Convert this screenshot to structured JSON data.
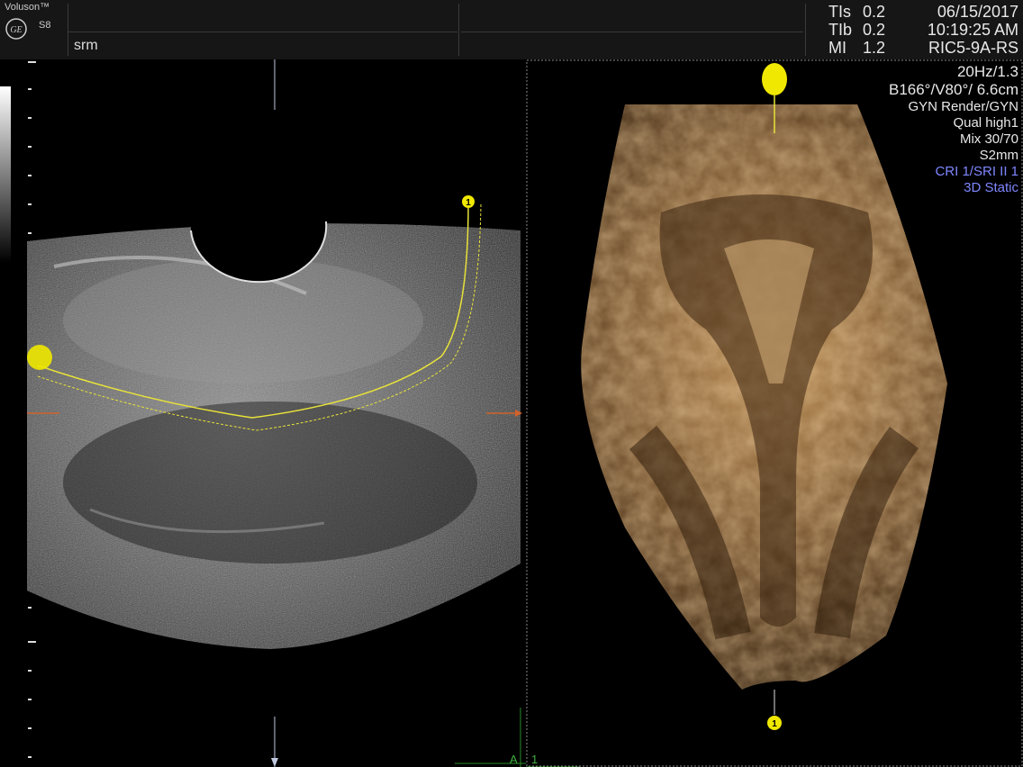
{
  "header": {
    "brand": "Voluson™",
    "logo_text": "GE",
    "model": "S8",
    "patient_id": "srm",
    "params": [
      {
        "label": "TIs",
        "value": "0.2"
      },
      {
        "label": "TIb",
        "value": "0.2"
      },
      {
        "label": "MI",
        "value": "1.2"
      }
    ],
    "date": "06/15/2017",
    "time": "10:19:25 AM",
    "probe": "RIC5-9A-RS"
  },
  "acquisition": {
    "frame_rate": "20Hz/1.3",
    "angles_depth": "B166°/V80°/ 6.6cm",
    "preset": "GYN Render/GYN",
    "quality": "Qual high1",
    "mix": "Mix 30/70",
    "slice": "S2mm",
    "cri_sri": "CRI 1/SRI II 1",
    "mode": "3D Static"
  },
  "markers": {
    "curve_marker": "1",
    "render_marker": "1",
    "plane_label": "A",
    "plane_number": "1"
  },
  "colors": {
    "curve": "#e8e23a",
    "marker": "#f0e800",
    "orange": "#d0622a",
    "green": "#2a8a2a",
    "info_blue": "#7f86ff"
  }
}
